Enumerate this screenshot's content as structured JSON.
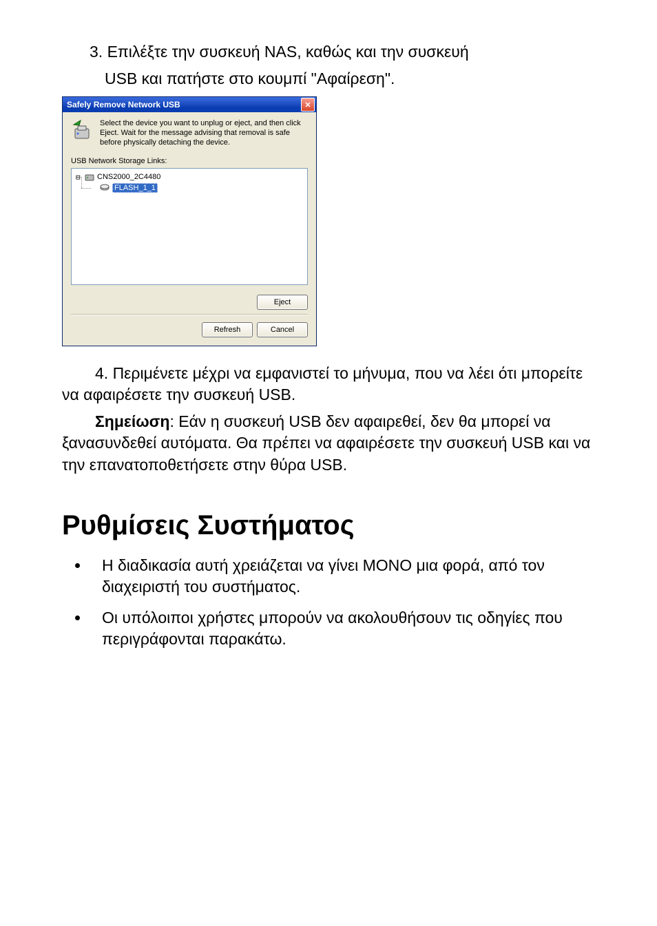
{
  "para_step3_line1": "3.  Επιλέξτε την συσκευή NAS, καθώς και την συσκευή",
  "para_step3_line2": "USB και πατήστε στο κουμπί \"Αφαίρεση\".",
  "dialog": {
    "title": "Safely Remove Network USB",
    "intro": "Select the device you want to unplug or eject, and then click Eject. Wait for the message advising that removal is safe before physically detaching the device.",
    "links_label": "USB Network Storage Links:",
    "root_node": "CNS2000_2C4480",
    "child_node": "FLASH_1_1",
    "eject": "Eject",
    "refresh": "Refresh",
    "cancel": "Cancel"
  },
  "para_step4": "4.  Περιμένετε μέχρι να εμφανιστεί το μήνυμα, που να λέει ότι μπορείτε να αφαιρέσετε την συσκευή USB.",
  "note_label": "Σημείωση",
  "note_body": ": Εάν η συσκευή USB δεν αφαιρεθεί, δεν θα μπορεί να ξανασυνδεθεί αυτόματα. Θα πρέπει να αφαιρέσετε την συσκευή USB και να την επανατοποθετήσετε στην θύρα USB.",
  "section_title": "Ρυθμίσεις Συστήματος",
  "bullet1": "Η διαδικασία αυτή χρειάζεται να γίνει ΜΟΝΟ μια φορά, από τον διαχειριστή του συστήματος.",
  "bullet2": "Οι υπόλοιποι χρήστες μπορούν να ακολουθήσουν τις οδηγίες που περιγράφονται παρακάτω."
}
